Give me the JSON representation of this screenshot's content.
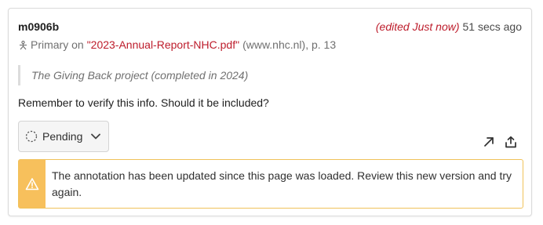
{
  "annotation": {
    "username": "m0906b",
    "edited_label": "(edited Just now)",
    "timestamp": "51 secs ago",
    "source": {
      "prefix": "Primary on",
      "document_title": "\"2023-Annual-Report-NHC.pdf\"",
      "domain_and_page": "(www.nhc.nl), p. 13"
    },
    "quote": "The Giving Back project (completed in 2024)",
    "body": "Remember to verify this info. Should it be included?",
    "state_label": "Pending",
    "alert_message": "The annotation has been updated since this page was loaded. Review this new version and try again."
  },
  "icons": {
    "source_icon": "annotation-tag-icon",
    "state_icon": "pending-dashed-circle-icon",
    "state_chevron": "chevron-down-icon",
    "open_icon": "arrow-up-right-icon",
    "share_icon": "share-upload-icon",
    "alert_icon": "warning-triangle-icon"
  },
  "colors": {
    "accent_red": "#bd1c2b",
    "warning_yellow": "#f7c05c",
    "warning_border": "#f0c25a"
  }
}
